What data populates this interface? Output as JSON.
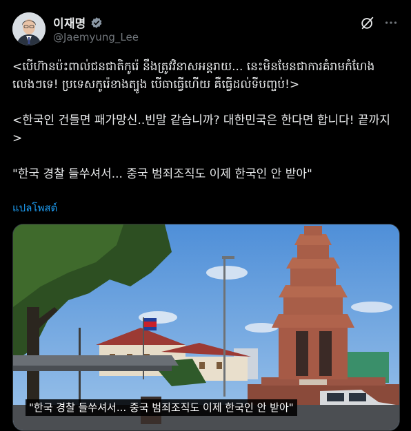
{
  "author": {
    "display_name": "이재명",
    "handle": "@Jaemyung_Lee",
    "verified": true
  },
  "icons": {
    "verified": "verified-badge-icon",
    "grok": "grok-icon",
    "more": "more-options-icon"
  },
  "tweet": {
    "khmer_text": "<បើហ៊ានប៉ះពាល់ជនជាតិកូរ៉េ នឹងត្រូវវិនាសអន្តរាយ... នេះមិនមែនជាការគំរាមកំហែងលេងៗទេ! ប្រទេសកូរ៉េខាងត្បូង បើធាធ្វើហើយ គឺធ្វើដល់ទីបញ្ចប់!>",
    "korean_text": "<한국인 건들면 패가망신..빈말 같습니까? 대한민국은 한다면 합니다! 끝까지>",
    "headline": "\"한국 경찰 들쑤셔서... 중국 범죄조직도 이제 한국인 안 받아\"",
    "translate_label": "แปลโพสต์"
  },
  "media": {
    "caption": "\"한국 경찰 들쑤셔서... 중국 범죄조직도 이제 한국인 안 받아\""
  },
  "colors": {
    "background": "#000000",
    "text": "#e7e9ea",
    "secondary": "#71767b",
    "link": "#1d9bf0",
    "verified": "#8b98a5"
  }
}
